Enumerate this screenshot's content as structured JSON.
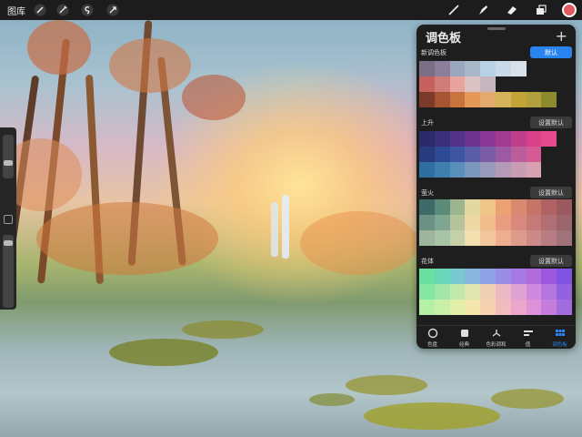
{
  "topbar": {
    "gallery_label": "图库",
    "left_icons": [
      "wrench-icon",
      "magic-wand-icon",
      "selection-icon",
      "transform-arrow-icon"
    ],
    "right_icons": [
      "brush-icon",
      "smudge-icon",
      "eraser-icon",
      "layers-icon"
    ],
    "current_color": "#e05a60"
  },
  "panel": {
    "title": "调色板",
    "add_label": "+",
    "palettes": [
      {
        "name": "新调色板",
        "default_label": "默认",
        "is_default": true,
        "swatches": [
          [
            "#7b6f86",
            "#8d7f9a",
            "#9aa7bf",
            "#a8b7c8",
            "#b9d1e4",
            "#cad9ea",
            "#d7e1ea",
            "#1e1e1e",
            "#1e1e1e",
            "#1e1e1e"
          ],
          [
            "#c8605e",
            "#d07c77",
            "#e8a49c",
            "#d9c3c4",
            "#c7b6c0",
            "#1e1e1e",
            "#1e1e1e",
            "#1e1e1e",
            "#1e1e1e",
            "#1e1e1e"
          ],
          [
            "#7c3a2b",
            "#a55533",
            "#c9743c",
            "#e59958",
            "#e2aa6f",
            "#d4b35a",
            "#c4a336",
            "#b0a03e",
            "#8c8a2e",
            "#1e1e1e"
          ]
        ]
      },
      {
        "name": "上升",
        "default_label": "设置默认",
        "is_default": false,
        "swatches": [
          [
            "#2b2a6b",
            "#3b2f7a",
            "#54328a",
            "#6c338f",
            "#883894",
            "#a23b8f",
            "#bf3f8b",
            "#d8418a",
            "#e44a8c",
            "#1e1e1e"
          ],
          [
            "#283b7e",
            "#2f4a95",
            "#3c56a3",
            "#5b5ca8",
            "#7a5ba6",
            "#9b5aa1",
            "#bb5c9b",
            "#d35a92",
            "#1e1e1e",
            "#1e1e1e"
          ],
          [
            "#2f6e9f",
            "#3e7fb0",
            "#5a8fbb",
            "#7b97bc",
            "#9a9bbc",
            "#b39bb8",
            "#c89cb3",
            "#d7a1b2",
            "#1e1e1e",
            "#1e1e1e"
          ]
        ]
      },
      {
        "name": "萤火",
        "default_label": "设置默认",
        "is_default": false,
        "swatches": [
          [
            "#3e6a68",
            "#5d8b79",
            "#9db58e",
            "#e2d9a0",
            "#f0c58a",
            "#eca172",
            "#d88a70",
            "#c67467",
            "#b06264",
            "#9a5a60"
          ],
          [
            "#6a9183",
            "#7ea690",
            "#b5c49b",
            "#eed8a4",
            "#f1bd8a",
            "#e99c80",
            "#d8897c",
            "#c57a78",
            "#b06f72",
            "#9b656b"
          ],
          [
            "#9fb49d",
            "#a8c4a6",
            "#c6d0a9",
            "#f2dfb0",
            "#f2c79e",
            "#edae90",
            "#de9a8b",
            "#cb8a88",
            "#b77d83",
            "#a2727b"
          ]
        ]
      },
      {
        "name": "花体",
        "default_label": "设置默认",
        "is_default": false,
        "swatches": [
          [
            "#68e0a0",
            "#69d6b8",
            "#78c8d0",
            "#88b6df",
            "#8fa2e6",
            "#9a8de8",
            "#a679e4",
            "#b46bdc",
            "#9c59e0",
            "#7f54e0"
          ],
          [
            "#86e6a4",
            "#a4e6a8",
            "#c3e8ac",
            "#e0e4b0",
            "#efd0b4",
            "#eab9c4",
            "#e0a2d2",
            "#cf8ade",
            "#b376e0",
            "#9462de"
          ],
          [
            "#b4f0a6",
            "#c9f0a8",
            "#e2efa9",
            "#f4e7ad",
            "#f6d2b0",
            "#f2bcbe",
            "#eca6cc",
            "#de90d8",
            "#c57cdc",
            "#a36cdc"
          ]
        ]
      }
    ],
    "tabs": [
      {
        "label": "色盘",
        "icon": "disc-icon",
        "active": false
      },
      {
        "label": "经典",
        "icon": "classic-square-icon",
        "active": false
      },
      {
        "label": "色彩调和",
        "icon": "harmony-icon",
        "active": false
      },
      {
        "label": "值",
        "icon": "value-sliders-icon",
        "active": false
      },
      {
        "label": "调色板",
        "icon": "palette-grid-icon",
        "active": true
      }
    ]
  }
}
